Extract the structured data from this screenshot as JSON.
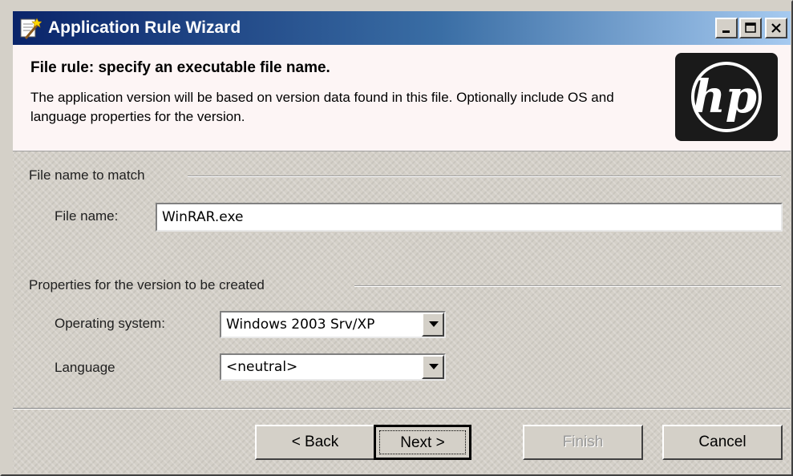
{
  "window": {
    "title": "Application Rule Wizard"
  },
  "header": {
    "title": "File rule: specify an executable file name.",
    "description": "The application version will be based on version data found in this file. Optionally include OS and language properties for the version.",
    "logo_text": "hp"
  },
  "file_group": {
    "label": "File name to match",
    "file_name_label": "File name:",
    "file_name_value": "WinRAR.exe"
  },
  "props_group": {
    "label": "Properties for the version to be created",
    "os_label": "Operating system:",
    "os_value": "Windows 2003 Srv/XP",
    "language_label": "Language",
    "language_value": "<neutral>"
  },
  "buttons": {
    "back": "< Back",
    "next": "Next >",
    "finish": "Finish",
    "cancel": "Cancel"
  },
  "icons": {
    "app": "wizard-wand-icon",
    "minimize": "minimize-icon",
    "maximize": "maximize-icon",
    "close": "close-icon",
    "dropdown": "chevron-down-icon"
  },
  "colors": {
    "titlebar_start": "#0a246a",
    "titlebar_end": "#a6caf0",
    "header_bg": "#fdf5f5",
    "face": "#d4d0c8"
  }
}
